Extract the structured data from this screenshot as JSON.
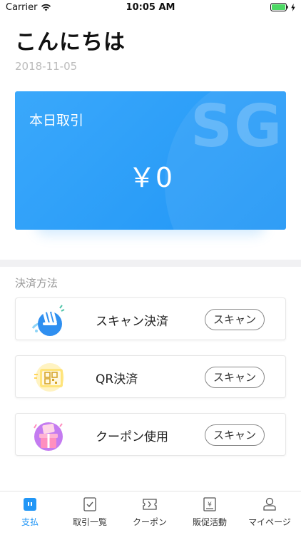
{
  "status_bar": {
    "carrier": "Carrier",
    "time": "10:05 AM",
    "wifi_icon": "wifi-icon",
    "battery_icon": "battery-icon",
    "charging_icon": "charging-bolt-icon"
  },
  "header": {
    "greeting": "こんにちは",
    "date": "2018-11-05"
  },
  "summary_card": {
    "title": "本日取引",
    "amount": "￥0",
    "watermark": "SG",
    "colors": {
      "start": "#3aa8fb",
      "end": "#2196f6"
    }
  },
  "payment_section": {
    "title": "決済方法",
    "methods": [
      {
        "label": "スキャン決済",
        "button": "スキャン",
        "icon": "scan-payment-icon"
      },
      {
        "label": "QR決済",
        "button": "スキャン",
        "icon": "qr-payment-icon"
      },
      {
        "label": "クーポン使用",
        "button": "スキャン",
        "icon": "coupon-gift-icon"
      }
    ]
  },
  "tab_bar": {
    "active_color": "#2196f6",
    "tabs": [
      {
        "label": "支払",
        "icon": "payment-tab-icon",
        "active": true
      },
      {
        "label": "取引一覧",
        "icon": "transactions-tab-icon",
        "active": false
      },
      {
        "label": "クーポン",
        "icon": "coupon-tab-icon",
        "active": false
      },
      {
        "label": "販促活動",
        "icon": "promotion-tab-icon",
        "active": false
      },
      {
        "label": "マイページ",
        "icon": "mypage-tab-icon",
        "active": false
      }
    ]
  }
}
